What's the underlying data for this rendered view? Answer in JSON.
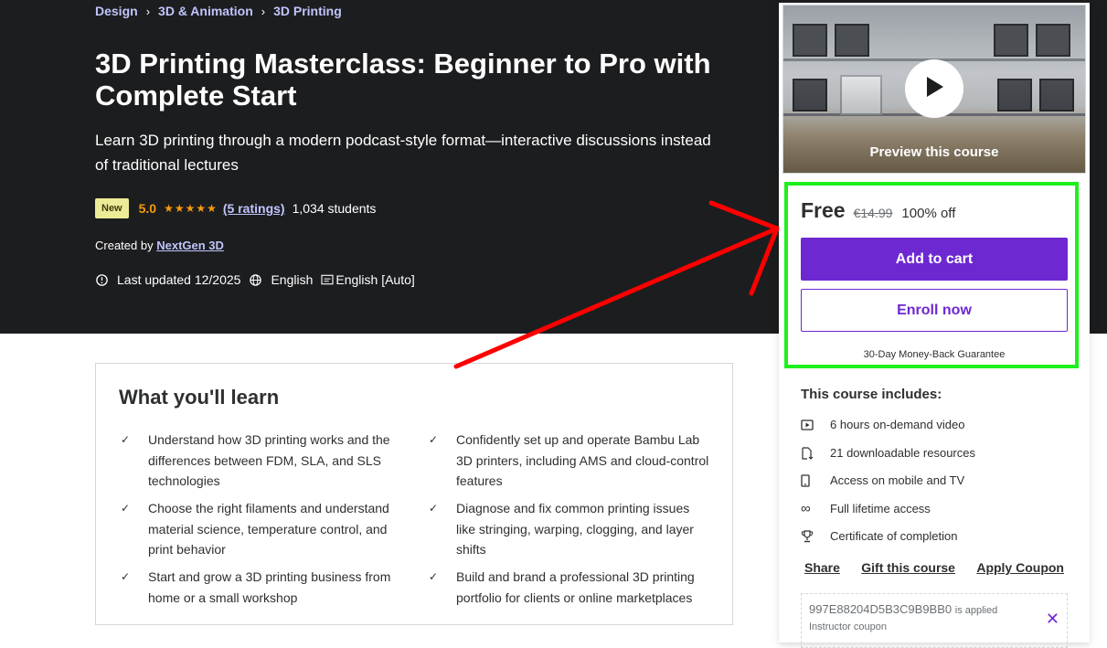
{
  "breadcrumb": [
    "Design",
    "3D & Animation",
    "3D Printing"
  ],
  "course": {
    "title": "3D Printing Masterclass: Beginner to Pro with Complete Start",
    "subtitle": "Learn 3D printing through a modern podcast-style format—interactive discussions instead of traditional lectures",
    "badge": "New",
    "rating": "5.0",
    "stars": 5,
    "ratings_count": "(5 ratings)",
    "students": "1,034 students",
    "created_label": "Created by",
    "instructor": "NextGen 3D",
    "last_updated": "Last updated 12/2025",
    "language": "English",
    "captions": "English [Auto]"
  },
  "learn": {
    "title": "What you'll learn",
    "items": [
      "Understand how 3D printing works and the differences between FDM, SLA, and SLS technologies",
      "Confidently set up and operate Bambu Lab 3D printers, including AMS and cloud-control features",
      "Choose the right filaments and understand material science, temperature control, and print behavior",
      "Diagnose and fix common printing issues like stringing, warping, clogging, and layer shifts",
      "Start and grow a 3D printing business from home or a small workshop",
      "Build and brand a professional 3D printing portfolio for clients or online marketplaces"
    ]
  },
  "sidebar": {
    "preview_label": "Preview this course",
    "price": "Free",
    "original_price": "€14.99",
    "discount": "100% off",
    "add_to_cart": "Add to cart",
    "enroll_now": "Enroll now",
    "guarantee": "30-Day Money-Back Guarantee",
    "includes_title": "This course includes:",
    "includes": [
      {
        "icon": "video-icon",
        "text": "6 hours on-demand video"
      },
      {
        "icon": "download-file-icon",
        "text": "21 downloadable resources"
      },
      {
        "icon": "mobile-icon",
        "text": "Access on mobile and TV"
      },
      {
        "icon": "infinity-icon",
        "text": "Full lifetime access"
      },
      {
        "icon": "trophy-icon",
        "text": "Certificate of completion"
      }
    ],
    "share": "Share",
    "gift": "Gift this course",
    "apply_coupon": "Apply Coupon",
    "coupon_code": "997E88204D5B3C9B9BB0",
    "coupon_applied": "is applied",
    "coupon_type": "Instructor coupon"
  },
  "colors": {
    "hero_bg": "#1c1d1f",
    "link_purple": "#c0c4fc",
    "brand_purple": "#6d28d2",
    "star_orange": "#f69c08",
    "highlight_green": "#1ef01e",
    "annotation_red": "#ff0000"
  }
}
